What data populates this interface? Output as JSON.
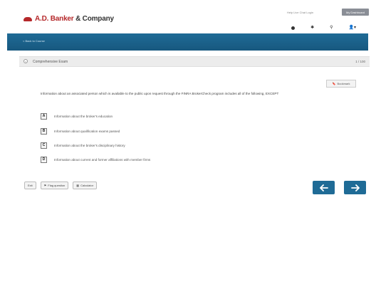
{
  "header": {
    "logo_brand": "A.D. Banker",
    "logo_company": " & Company",
    "top_links": "Help  Live Chat  Login",
    "top_button": "My Dashboard",
    "icons": [
      "account-dot-icon",
      "gear-icon",
      "search-icon",
      "user-icon"
    ]
  },
  "nav": {
    "breadcrumb": "< Back to Course"
  },
  "exam": {
    "title": "Comprehensive Exam",
    "counter": "1 / 100",
    "bookmark_label": "Bookmark"
  },
  "question": {
    "text": "Information about an associated person which is available to the public upon request through the FINRA BrokerCheck program includes all of the following, EXCEPT"
  },
  "options": [
    {
      "letter": "A",
      "text": "Information about the broker's education"
    },
    {
      "letter": "B",
      "text": "Information about qualification exams passed"
    },
    {
      "letter": "C",
      "text": "Information about the broker's disciplinary history"
    },
    {
      "letter": "D",
      "text": "Information about current and former affiliations with member firms"
    }
  ],
  "bottom": {
    "buttons": [
      "Exit",
      "Flag question",
      "Calculator"
    ]
  },
  "colors": {
    "brand_red": "#b5282a",
    "nav_blue": "#1f6b96"
  }
}
